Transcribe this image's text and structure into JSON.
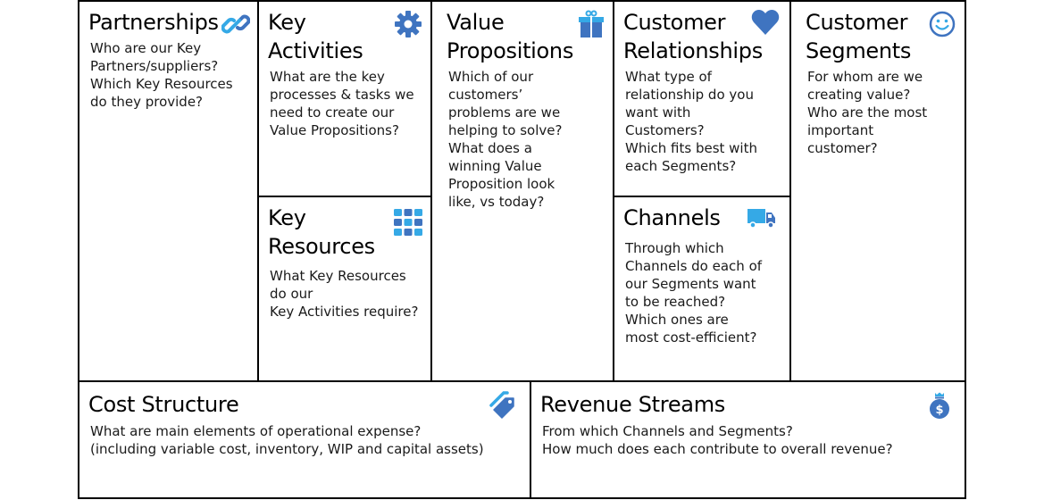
{
  "canvas": {
    "accent_dark": "#3f74c0",
    "accent_light": "#35a9e6"
  },
  "blocks": {
    "partnerships": {
      "title": "Partnerships",
      "description": "Who are our Key\nPartners/suppliers?\nWhich Key Resources\ndo they provide?",
      "icon": "link-icon"
    },
    "key_activities": {
      "title": "Key\nActivities",
      "description": "What are the key\nprocesses & tasks we\nneed to create our\nValue Propositions?",
      "icon": "gear-icon"
    },
    "key_resources": {
      "title": "Key\nResources",
      "description": "What Key Resources\ndo our\nKey Activities require?",
      "icon": "grid-icon"
    },
    "value_propositions": {
      "title": "Value\nPropositions",
      "description": "Which of our\ncustomers’\nproblems are we\nhelping to solve?\nWhat does a\nwinning Value\nProposition look\nlike, vs today?",
      "icon": "gift-icon"
    },
    "customer_relationships": {
      "title": "Customer\nRelationships",
      "description": "What type of\nrelationship do you\nwant with\nCustomers?\nWhich fits best with\neach Segments?",
      "icon": "heart-icon"
    },
    "channels": {
      "title": "Channels",
      "description": "Through which\nChannels do each of\nour Segments want\nto be reached?\nWhich ones are\nmost cost-efficient?",
      "icon": "truck-icon"
    },
    "customer_segments": {
      "title": "Customer\nSegments",
      "description": "For whom are we\ncreating value?\nWho are the most\nimportant\ncustomer?",
      "icon": "smiley-icon"
    },
    "cost_structure": {
      "title": "Cost Structure",
      "description": "What are main elements of operational expense?\n(including variable cost, inventory, WIP and capital assets)",
      "icon": "tag-icon"
    },
    "revenue_streams": {
      "title": "Revenue Streams",
      "description": "From which Channels and Segments?\nHow much does each contribute to overall revenue?",
      "icon": "money-bag-icon"
    }
  }
}
